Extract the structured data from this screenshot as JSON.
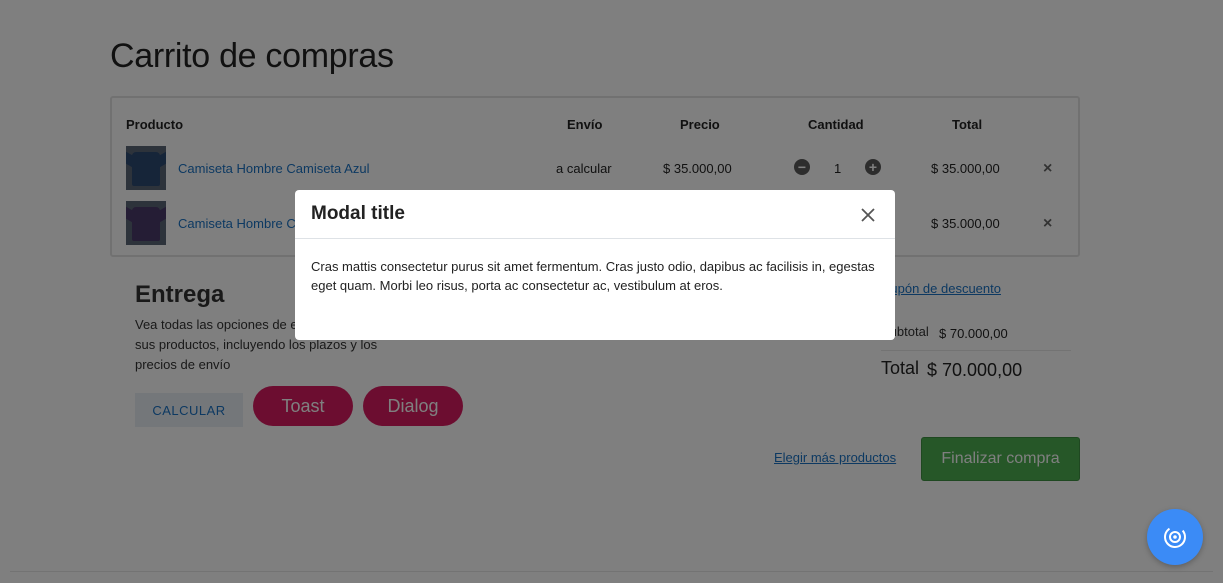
{
  "page": {
    "title": "Carrito de compras"
  },
  "table": {
    "headers": {
      "product": "Producto",
      "shipping": "Envío",
      "price": "Precio",
      "quantity": "Cantidad",
      "total": "Total"
    },
    "rows": [
      {
        "name": "Camiseta Hombre Camiseta Azul",
        "shipping": "a calcular",
        "price": "$ 35.000,00",
        "qty": "1",
        "total": "$ 35.000,00",
        "color": "#2d4a73"
      },
      {
        "name": "Camiseta Hombre C",
        "shipping": "",
        "price": "",
        "qty": "",
        "total": "$ 35.000,00",
        "color": "#4b3a6b"
      }
    ],
    "remove_icon": "×",
    "minus_icon": "−",
    "plus_icon": "+"
  },
  "delivery": {
    "title": "Entrega",
    "description": "Vea todas las opciones de entrega para sus productos, incluyendo los plazos y los precios de envío",
    "calculate_label": "CALCULAR"
  },
  "buttons": {
    "toast_label": "Toast",
    "dialog_label": "Dialog"
  },
  "summary": {
    "coupon_link": "Cupón de descuento",
    "subtotal_label": "Subtotal",
    "subtotal_value": "$ 70.000,00",
    "total_label": "Total",
    "total_value": "$ 70.000,00"
  },
  "actions": {
    "more_products": "Elegir más productos",
    "checkout": "Finalizar compra"
  },
  "modal": {
    "title": "Modal title",
    "body": "Cras mattis consectetur purus sit amet fermentum. Cras justo odio, dapibus ac facilisis in, egestas eget quam. Morbi leo risus, porta ac consectetur ac, vestibulum at eros."
  },
  "colors": {
    "accent_link": "#1a73c4",
    "pink": "#d81b60",
    "green": "#4caf50",
    "fab_blue": "#3b8bf6"
  },
  "icons": {
    "close": "close-icon",
    "fab": "target-icon",
    "shirt": "tshirt-icon"
  }
}
